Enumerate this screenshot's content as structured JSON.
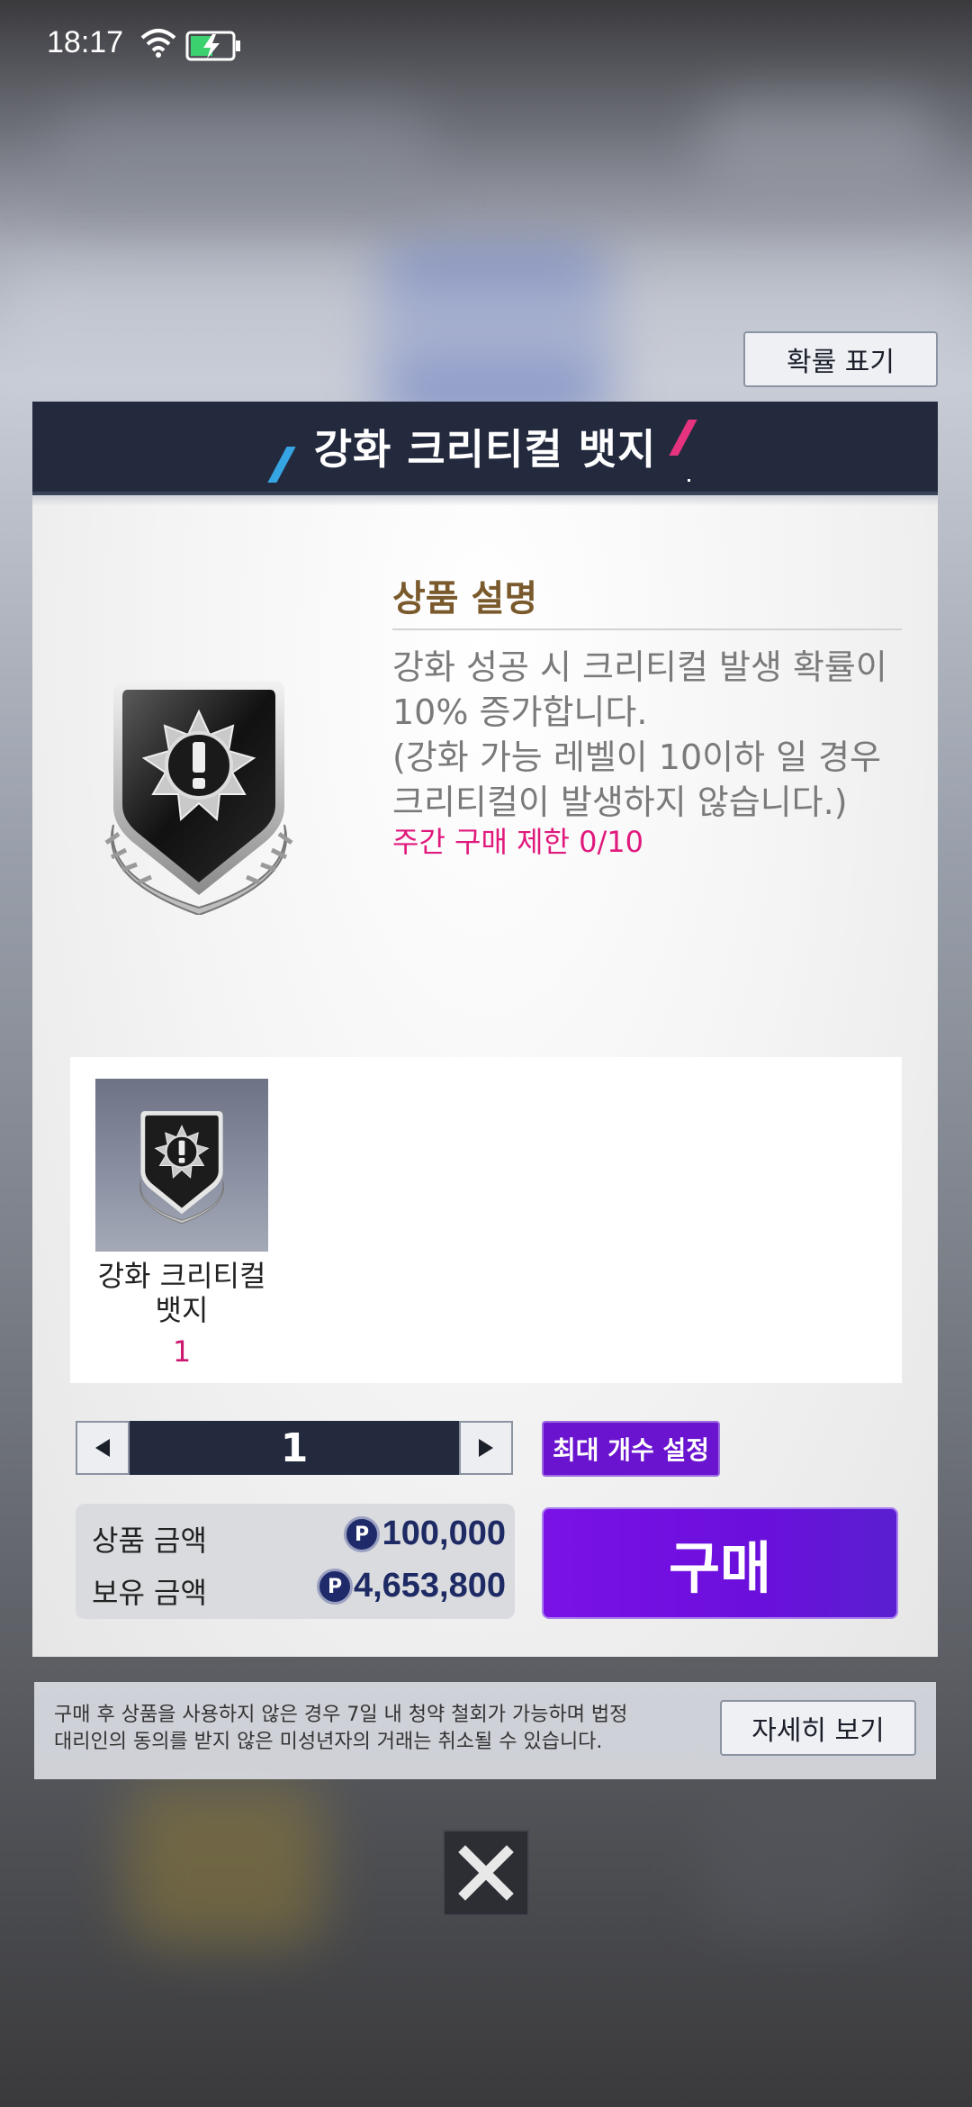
{
  "status_bar": {
    "time": "18:17"
  },
  "probability_button": "확률 표기",
  "dialog": {
    "title": "강화 크리티컬 뱃지",
    "description_heading": "상품 설명",
    "description": "강화 성공 시 크리티컬 발생 확률이\n10% 증가합니다.\n(강화 가능 레벨이 10이하 일 경우\n크리티컬이 발생하지 않습니다.)",
    "weekly_limit": "주간 구매 제한 0/10",
    "items": [
      {
        "name": "강화 크리티컬\n뱃지",
        "count": "1"
      }
    ],
    "quantity": "1",
    "max_button": "최대 개수 설정",
    "price_label": "상품 금액",
    "price_value": "100,000",
    "balance_label": "보유 금액",
    "balance_value": "4,653,800",
    "currency_icon_letter": "P",
    "buy_button": "구매"
  },
  "notice": {
    "text": "구매 후 상품을 사용하지 않은 경우 7일 내 청약 철회가 가능하며 법정\n대리인의 동의를 받지 않은 미성년자의 거래는 취소될 수 있습니다.",
    "detail_button": "자세히 보기"
  },
  "colors": {
    "title_bar": "#232a3e",
    "buy_button": "#6b0fdc",
    "limit_text": "#e0197d",
    "heading_text": "#7a5a2c"
  }
}
